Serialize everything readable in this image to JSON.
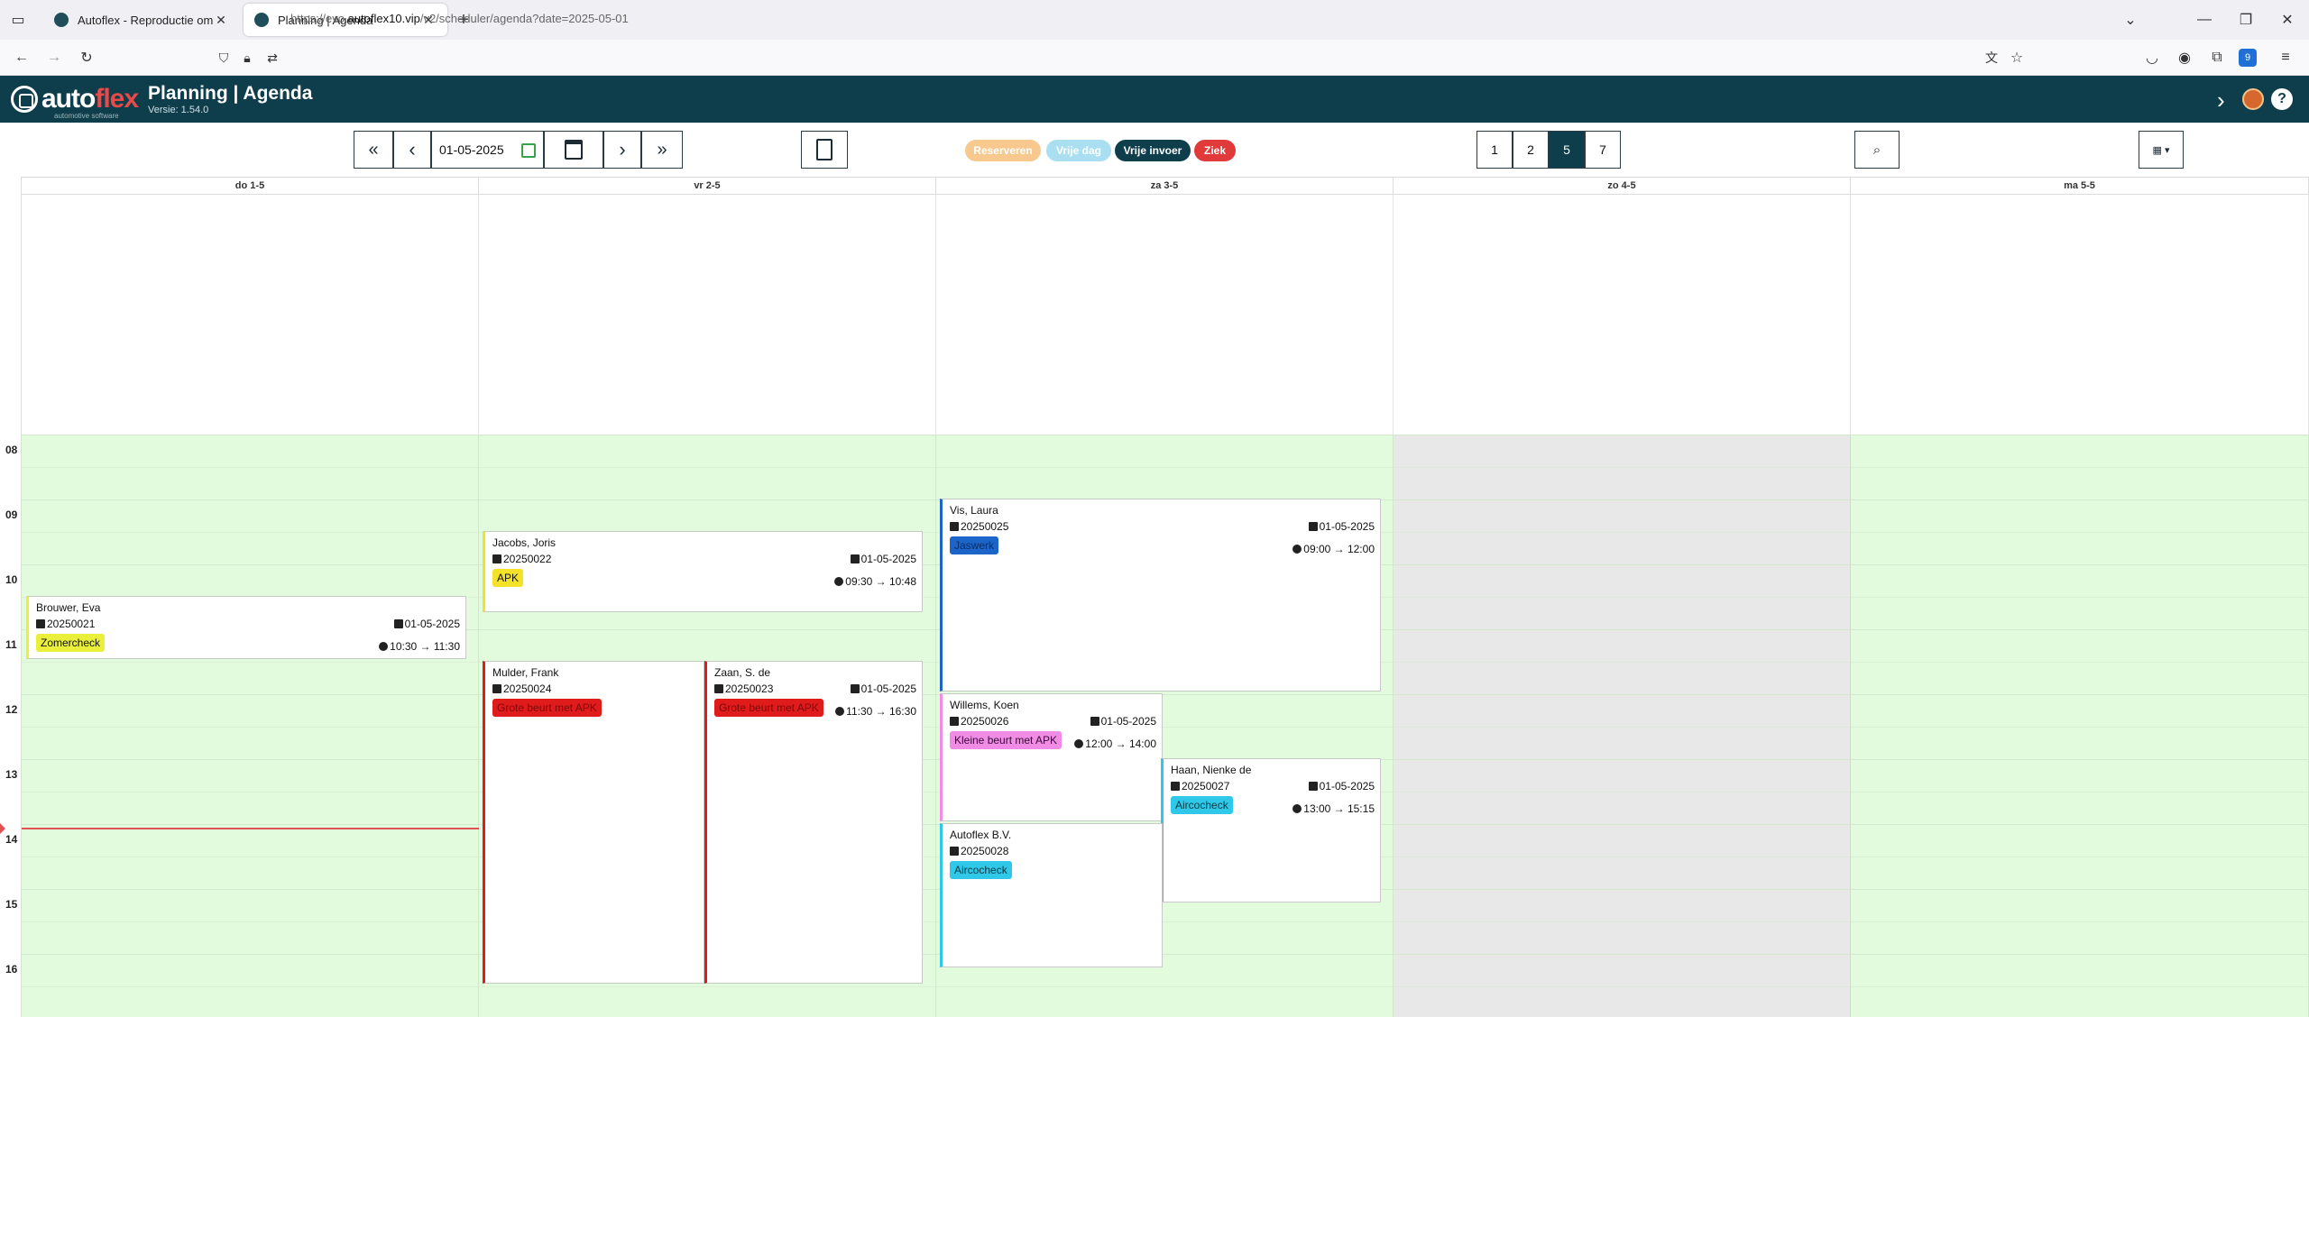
{
  "browser": {
    "tabs": [
      {
        "title": "Autoflex - Reproductie omgevi",
        "active": false
      },
      {
        "title": "Planning | Agenda",
        "active": true
      }
    ],
    "new_tab_glyph": "+",
    "url_prefix": "https://evo.",
    "url_domain": "autoflex10.vip",
    "url_path": "/v2/scheduler/agenda?date=2025-05-01",
    "icons": [
      "tab-list-icon",
      "back-icon",
      "forward-icon",
      "reload-icon",
      "shield-icon",
      "lock-icon",
      "translate-icon",
      "star-icon",
      "pocket-icon",
      "account-icon",
      "extensions-icon",
      "menu-icon"
    ]
  },
  "app": {
    "logo_text_a": "auto",
    "logo_text_b": "flex",
    "logo_sub": "automotive software",
    "title": "Planning | Agenda",
    "version": "Versie: 1.54.0",
    "colors": {
      "header": "#0e3d4b",
      "logo_accent": "#e84a4a"
    }
  },
  "toolbar": {
    "first_glyph": "«",
    "prev_glyph": "‹",
    "date_value": "01-05-2025",
    "next_glyph": "›",
    "last_glyph": "»",
    "pills": [
      {
        "label": "Reserveren",
        "bg": "#f7c98f",
        "fg": "#ffffff"
      },
      {
        "label": "Vrije dag",
        "bg": "#a9dff0",
        "fg": "#ffffff"
      },
      {
        "label": "Vrije invoer",
        "bg": "#0e3d4b",
        "fg": "#ffffff"
      },
      {
        "label": "Ziek",
        "bg": "#e03a3a",
        "fg": "#ffffff"
      }
    ],
    "day_options": [
      "1",
      "2",
      "5",
      "7"
    ],
    "selected_days": "5"
  },
  "calendar": {
    "days": [
      {
        "label": "do 1-5",
        "type": "work"
      },
      {
        "label": "vr 2-5",
        "type": "work"
      },
      {
        "label": "za 3-5",
        "type": "work"
      },
      {
        "label": "zo 4-5",
        "type": "off"
      },
      {
        "label": "ma 5-5",
        "type": "work"
      }
    ],
    "hours": [
      "08",
      "09",
      "10",
      "11",
      "12",
      "13",
      "14",
      "15",
      "16"
    ],
    "colors": {
      "work": "#e3fbdd",
      "off": "#e8e8e8",
      "now": "#e05252"
    },
    "events": [
      {
        "name": "Brouwer, Eva",
        "number": "20250021",
        "date": "01-05-2025",
        "time": "10:30 → 11:30",
        "tag": "Zomercheck",
        "tag_bg": "#e9ef3a",
        "tag_fg": "#111111",
        "border": "#e9ef3a"
      },
      {
        "name": "Jacobs, Joris",
        "number": "20250022",
        "date": "01-05-2025",
        "time": "09:30 → 10:48",
        "tag": "APK",
        "tag_bg": "#f3e12a",
        "tag_fg": "#111111",
        "border": "#f3e12a"
      },
      {
        "name": "Mulder, Frank",
        "number": "20250024",
        "date": "",
        "time": "",
        "tag": "Grote beurt met APK",
        "tag_bg": "#e01b1b",
        "tag_fg": "#7a0a0a",
        "border": "#e01b1b"
      },
      {
        "name": "Zaan, S. de",
        "number": "20250023",
        "date": "01-05-2025",
        "time": "11:30 → 16:30",
        "tag": "Grote beurt met APK",
        "tag_bg": "#e01b1b",
        "tag_fg": "#7a0a0a",
        "border": "#e01b1b"
      },
      {
        "name": "Vis, Laura",
        "number": "20250025",
        "date": "01-05-2025",
        "time": "09:00 → 12:00",
        "tag": "Jaswerk",
        "tag_bg": "#1c64c8",
        "tag_fg": "#0b2f66",
        "border": "#1c64c8"
      },
      {
        "name": "Willems, Koen",
        "number": "20250026",
        "date": "01-05-2025",
        "time": "12:00 → 14:00",
        "tag": "Kleine beurt met APK",
        "tag_bg": "#f08be6",
        "tag_fg": "#3a0a36",
        "border": "#f08be6"
      },
      {
        "name": "Haan, Nienke de",
        "number": "20250027",
        "date": "01-05-2025",
        "time": "13:00 → 15:15",
        "tag": "Aircocheck",
        "tag_bg": "#2fc8e8",
        "tag_fg": "#0b3a44",
        "border": "#2fc8e8"
      },
      {
        "name": "Autoflex B.V.",
        "number": "20250028",
        "date": "",
        "time": "",
        "tag": "Aircocheck",
        "tag_bg": "#2fc8e8",
        "tag_fg": "#0b3a44",
        "border": "#2fc8e8"
      }
    ]
  }
}
